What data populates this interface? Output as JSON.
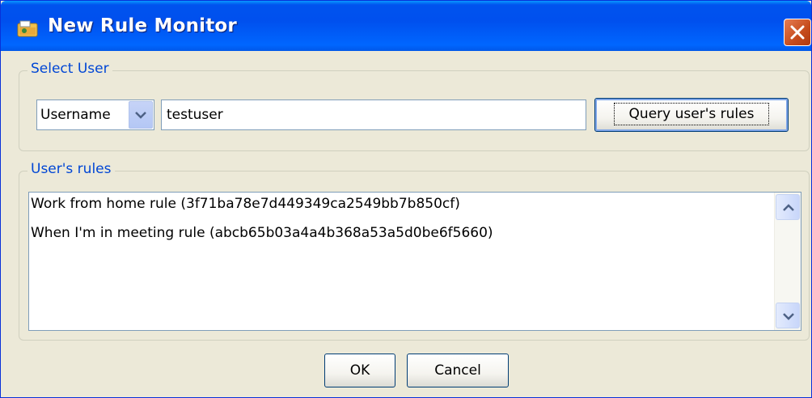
{
  "window": {
    "title": "New Rule Monitor",
    "icon": "rule-monitor-icon",
    "close_icon": "close-icon"
  },
  "select_user": {
    "legend": "Select User",
    "field_type": "Username",
    "username_value": "testuser",
    "query_button": "Query user's rules"
  },
  "rules": {
    "legend": "User's rules",
    "items": [
      "Work from home rule (3f71ba78e7d449349ca2549bb7b850cf)",
      "When I'm in meeting rule (abcb65b03a4a4b368a53a5d0be6f5660)"
    ]
  },
  "footer": {
    "ok_label": "OK",
    "cancel_label": "Cancel"
  },
  "colors": {
    "title_bar": "#0053ee",
    "legend_text": "#0046d5",
    "close_button": "#c54b1c",
    "window_bg": "#ece9d8"
  }
}
